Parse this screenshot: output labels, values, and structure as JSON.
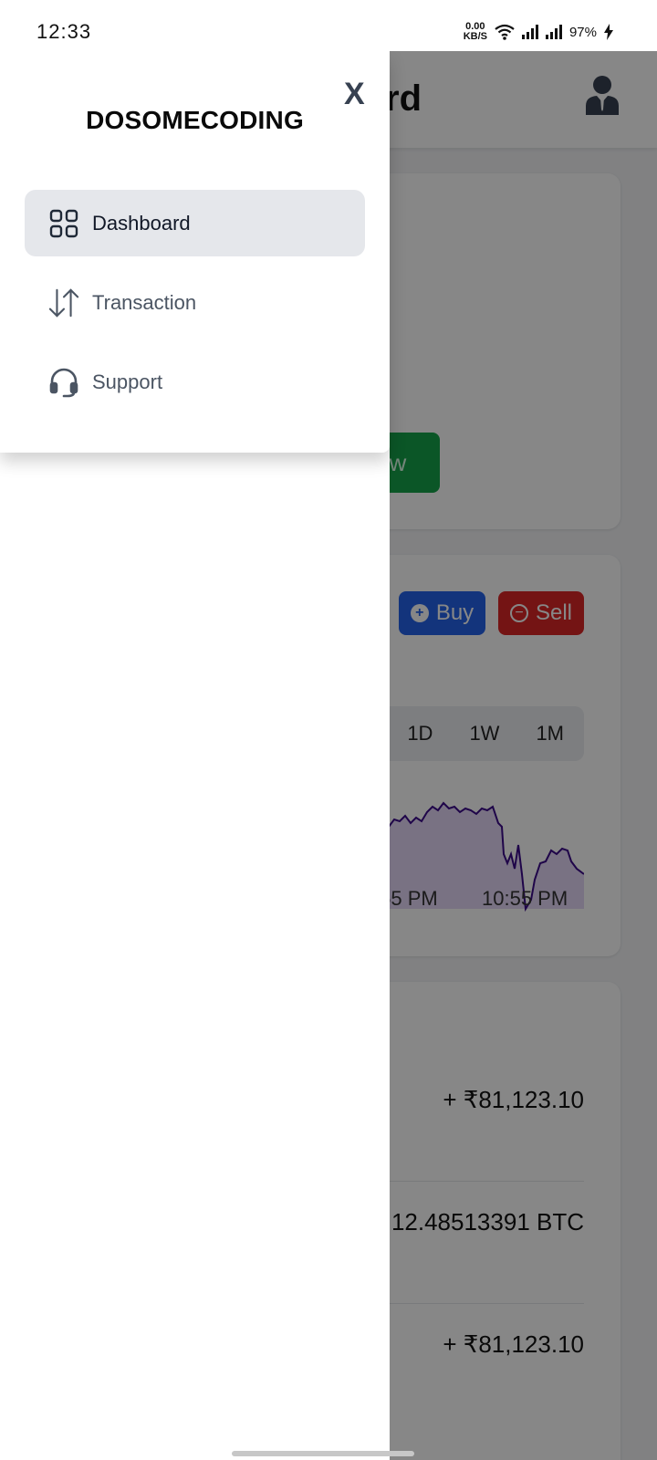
{
  "status_bar": {
    "time": "12:33",
    "net_speed_value": "0.00",
    "net_speed_unit": "KB/S",
    "battery": "97%"
  },
  "drawer": {
    "brand": "DOSOMECODING",
    "close_label": "X",
    "items": [
      {
        "label": "Dashboard",
        "icon": "grid-icon",
        "active": true
      },
      {
        "label": "Transaction",
        "icon": "arrows-up-down-icon",
        "active": false
      },
      {
        "label": "Support",
        "icon": "headset-icon",
        "active": false
      }
    ]
  },
  "background": {
    "header_title_visible": "rd",
    "withdraw_label_visible": "aw",
    "buy_label": "Buy",
    "sell_label": "Sell",
    "ranges": [
      "1D",
      "1W",
      "1M"
    ],
    "chart_time_labels": [
      ":55 PM",
      "10:55 PM"
    ],
    "rows": [
      {
        "value": "+ ₹81,123.10"
      },
      {
        "value": "12.48513391 BTC"
      },
      {
        "value": "+ ₹81,123.10"
      }
    ],
    "colors": {
      "withdraw": "#16a34a",
      "buy": "#2563eb",
      "sell": "#dc2626",
      "chart_line": "#3b0a8a"
    }
  }
}
